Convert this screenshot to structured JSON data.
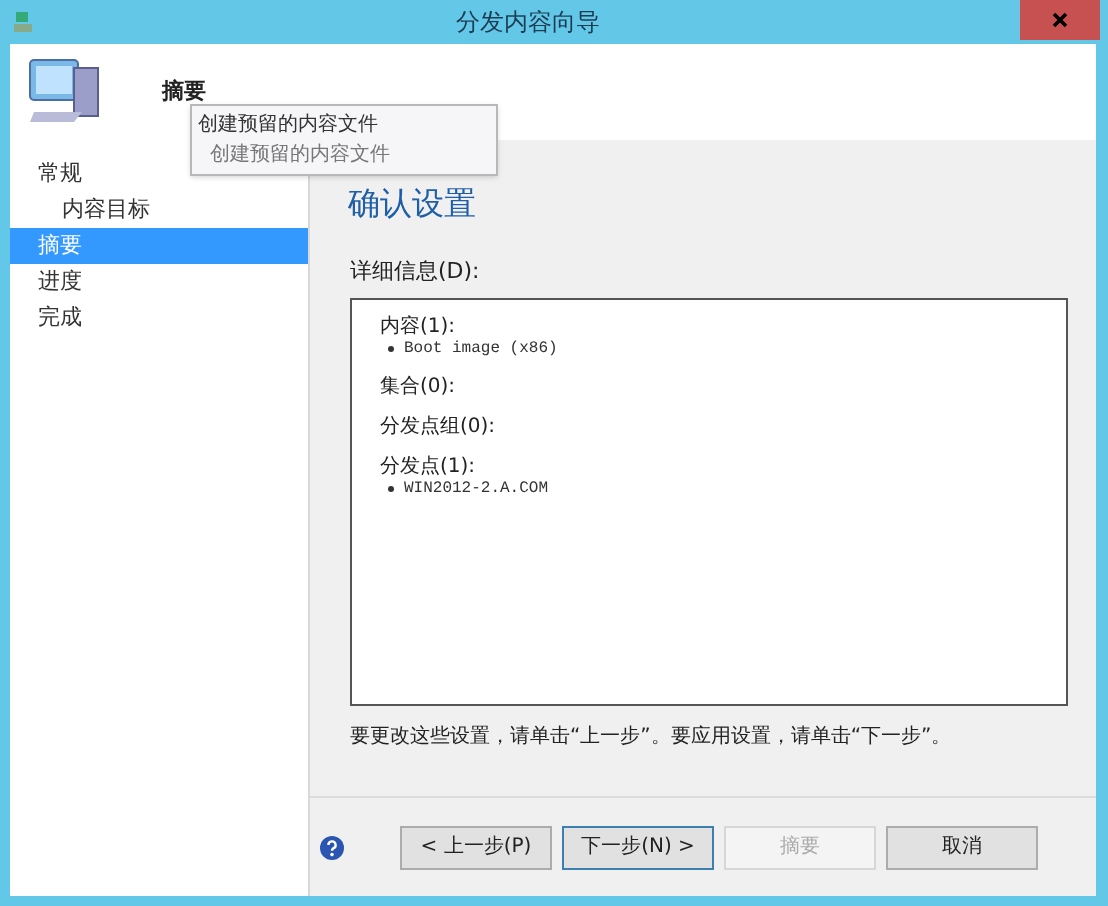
{
  "window": {
    "title": "分发内容向导"
  },
  "header": {
    "title": "摘要"
  },
  "tooltip": {
    "title": "创建预留的内容文件",
    "subtitle": "创建预留的内容文件"
  },
  "sidebar": {
    "items": [
      {
        "label": "常规",
        "selected": false,
        "children": [
          {
            "label": "内容目标",
            "selected": false
          }
        ]
      },
      {
        "label": "摘要",
        "selected": true
      },
      {
        "label": "进度",
        "selected": false
      },
      {
        "label": "完成",
        "selected": false
      }
    ]
  },
  "content": {
    "heading": "确认设置",
    "details_label": "详细信息(D):",
    "sections": [
      {
        "title": "内容(1):",
        "items": [
          "Boot image (x86)"
        ]
      },
      {
        "title": "集合(0):"
      },
      {
        "title": "分发点组(0):"
      },
      {
        "title": "分发点(1):",
        "items": [
          "WIN2012-2.A.COM"
        ]
      }
    ],
    "note": "要更改这些设置，请单击“上一步”。要应用设置，请单击“下一步”。"
  },
  "buttons": [
    {
      "label": "< 上一步(P)",
      "disabled": false,
      "selected": false
    },
    {
      "label": "下一步(N) >",
      "disabled": false,
      "selected": true
    },
    {
      "label": "摘要",
      "disabled": true,
      "selected": false
    },
    {
      "label": "取消",
      "disabled": false,
      "selected": false
    }
  ]
}
